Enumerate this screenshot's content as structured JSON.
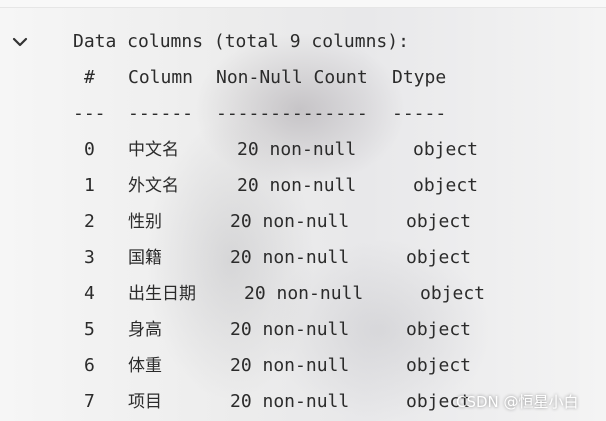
{
  "summary": "Data columns (total 9 columns):",
  "header": {
    "num": "#",
    "column": "Column",
    "count": "Non-Null Count",
    "dtype": "Dtype"
  },
  "separator": {
    "num": "---",
    "column": "------",
    "count": "--------------",
    "dtype": "-----"
  },
  "rows": [
    {
      "num": "0",
      "column": "中文名",
      "count": "20 non-null",
      "dtype": "object"
    },
    {
      "num": "1",
      "column": "外文名",
      "count": "20 non-null",
      "dtype": "object"
    },
    {
      "num": "2",
      "column": "性别",
      "count": "20 non-null",
      "dtype": "object"
    },
    {
      "num": "3",
      "column": "国籍",
      "count": "20 non-null",
      "dtype": "object"
    },
    {
      "num": "4",
      "column": "出生日期",
      "count": "20 non-null",
      "dtype": "object"
    },
    {
      "num": "5",
      "column": "身高",
      "count": "20 non-null",
      "dtype": "object"
    },
    {
      "num": "6",
      "column": "体重",
      "count": "20 non-null",
      "dtype": "object"
    },
    {
      "num": "7",
      "column": "项目",
      "count": "20 non-null",
      "dtype": "object"
    }
  ],
  "watermark": "CSDN @恒星小白",
  "icons": {
    "toggle": "chevron-down-icon"
  }
}
